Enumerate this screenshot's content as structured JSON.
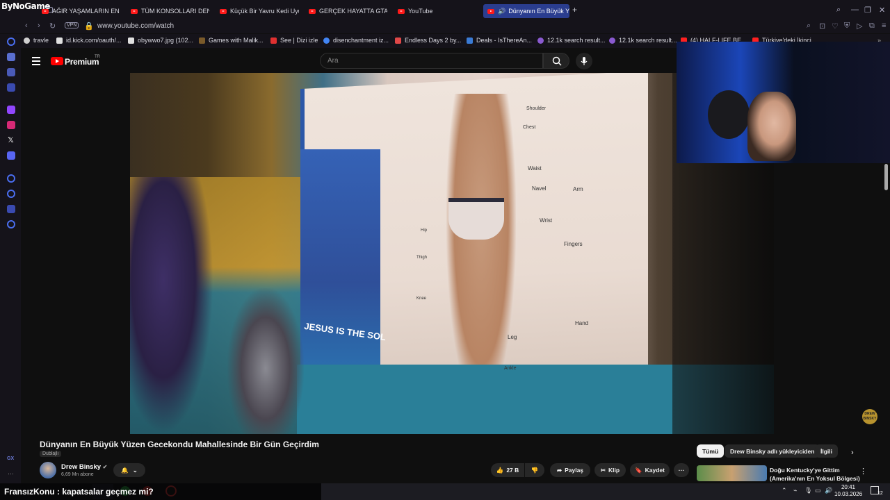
{
  "browser": {
    "brand": "ByNoGame",
    "tabs": [
      {
        "label": "AĞIR YAŞAMLARIN EN İĞR"
      },
      {
        "label": "TÜM KONSOLLARI DENED"
      },
      {
        "label": "Küçük Bir Yavru Kedi Uyu"
      },
      {
        "label": "GERÇEK HAYATTA GTA VI"
      },
      {
        "label": "YouTube"
      },
      {
        "label": "Dünyanın En Büyük Yü"
      }
    ],
    "new_tab": "+",
    "url": "www.youtube.com/watch",
    "vpn": "VPN",
    "bookmarks": [
      {
        "label": "travle",
        "color": "#d0d0d0"
      },
      {
        "label": "id.kick.com/oauth/...",
        "color": "#e0e0e0"
      },
      {
        "label": "obywwo7.jpg (102...",
        "color": "#e0e0e0"
      },
      {
        "label": "Games with Malik...",
        "color": "#7a5a2a"
      },
      {
        "label": "See | Dizi izle",
        "color": "#e03030"
      },
      {
        "label": "disenchantment iz...",
        "color": "#4285f4"
      },
      {
        "label": "Endless Days 2 by...",
        "color": "#e04848"
      },
      {
        "label": "Deals - IsThereAn...",
        "color": "#3a7bd5"
      },
      {
        "label": "12.1k search result...",
        "color": "#8a5ad0"
      },
      {
        "label": "12.1k search result...",
        "color": "#8a5ad0"
      },
      {
        "label": "(4) HALF-LIFE BE...",
        "color": "#ff2020"
      },
      {
        "label": "Türkiye'deki İkinci...",
        "color": "#ff2020"
      }
    ]
  },
  "youtube": {
    "premium": "Premium",
    "region": "TR",
    "search_placeholder": "Ara",
    "video_title": "Dünyanın En Büyük Yüzen Gecekondu Mahallesinde Bir Gün Geçirdim",
    "dub_label": "Dublajlı",
    "channel": "Drew Binsky",
    "subscribers": "6,69 Mn abone",
    "likes": "27 B",
    "share": "Paylaş",
    "clip": "Klip",
    "save": "Kaydet",
    "filter_chips": [
      "Tümü",
      "Drew Binsky adlı yükleyiciden",
      "İlgili"
    ],
    "rec_title_1": "Doğu Kentucky'ye Gittim",
    "rec_title_2": "(Amerika'nın En Yoksul Bölgesi)",
    "video_text": {
      "jesus_banner": "JESUS IS THE SOL",
      "labels": [
        "Shoulder",
        "Chest",
        "Waist",
        "Navel",
        "Arm",
        "Wrist",
        "Fingers",
        "Thigh",
        "Hand",
        "Leg",
        "Ankle",
        "Knee",
        "Hip"
      ],
      "watermark": "DREW BINSKY"
    }
  },
  "overlay": {
    "caption": "FransızKonu : kapatsalar geçmez mi?"
  },
  "system": {
    "time": "20:41",
    "date": "10.03.2026",
    "notif_count": "12"
  }
}
